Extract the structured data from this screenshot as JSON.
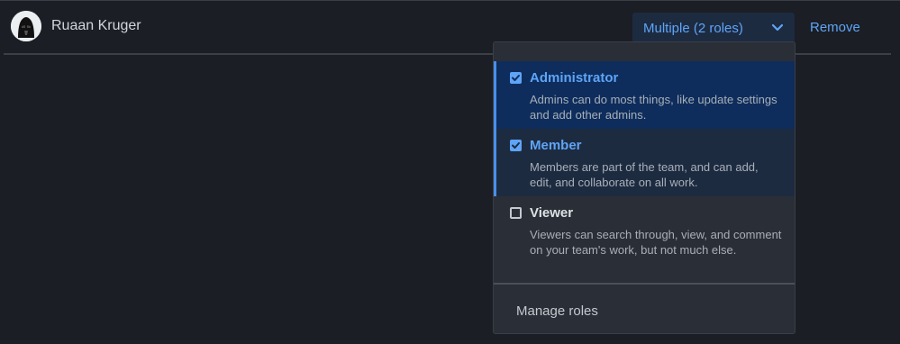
{
  "user": {
    "name": "Ruaan Kruger",
    "avatar_icon": "darth-vader-avatar-icon"
  },
  "roles_dropdown": {
    "label": "Multiple (2 roles)",
    "chevron_icon": "chevron-down-icon"
  },
  "remove_label": "Remove",
  "roles": [
    {
      "title": "Administrator",
      "description": "Admins can do most things, like update settings and add other admins.",
      "checked": true
    },
    {
      "title": "Member",
      "description": "Members are part of the team, and can add, edit, and collaborate on all work.",
      "checked": true
    },
    {
      "title": "Viewer",
      "description": "Viewers can search through, view, and comment on your team's work, but not much else.",
      "checked": false
    }
  ],
  "manage_roles_label": "Manage roles",
  "colors": {
    "accent": "#5ea4f7",
    "background": "#1b1e24",
    "menu_bg": "#2a2e36",
    "selected_bg": "#0e2d5c"
  }
}
